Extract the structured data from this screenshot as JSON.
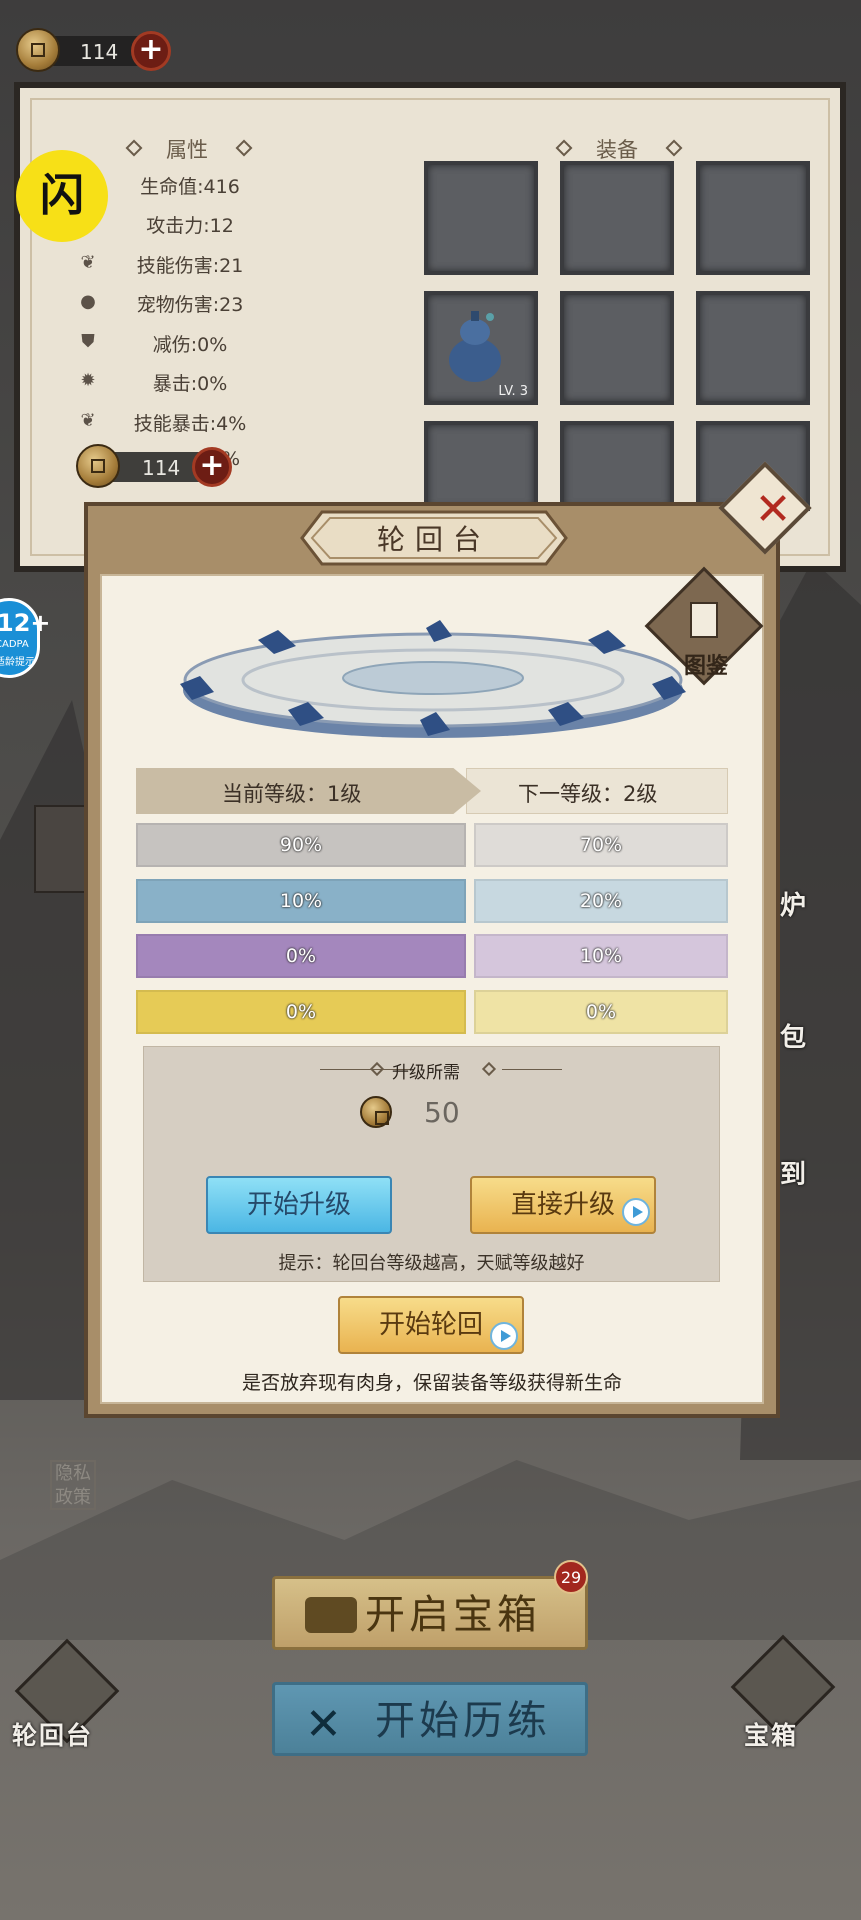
{
  "top_bar": {
    "coins": "114"
  },
  "stats_panel": {
    "attributes_title": "属性",
    "equipment_title": "装备",
    "stats": [
      {
        "label": "生命值:416",
        "icon": "heart-icon"
      },
      {
        "label": "攻击力:12",
        "icon": "sword-icon"
      },
      {
        "label": "技能伤害:21",
        "icon": "leaf-icon"
      },
      {
        "label": "宠物伤害:23",
        "icon": "paw-icon"
      },
      {
        "label": "减伤:0%",
        "icon": "shield-icon"
      },
      {
        "label": "暴击:0%",
        "icon": "burst-icon"
      },
      {
        "label": "技能暴击:4%",
        "icon": "leaf-icon"
      },
      {
        "label": "0%",
        "icon": "flame-icon"
      }
    ],
    "equipment_item_level": "LV. 3",
    "coins": "114"
  },
  "badge_flash": "闪",
  "age_rating": {
    "age": "12+",
    "line1": "CADPA",
    "line2": "适龄提示"
  },
  "modal": {
    "title": "轮回台",
    "illustrations_label": "图鉴",
    "current_level": "当前等级：1级",
    "next_level": "下一等级：2级",
    "rates": [
      {
        "current": "90%",
        "next": "70%",
        "color": "#c6c3c0",
        "next_color": "#dfdcd8"
      },
      {
        "current": "10%",
        "next": "20%",
        "color": "#89b1c8",
        "next_color": "#c7d8e0"
      },
      {
        "current": "0%",
        "next": "10%",
        "color": "#a487bd",
        "next_color": "#d5c6dc"
      },
      {
        "current": "0%",
        "next": "0%",
        "color": "#e6cb56",
        "next_color": "#efe3a5"
      }
    ],
    "requirement_title": "升级所需",
    "requirement_cost": "50",
    "start_upgrade": "开始升级",
    "direct_upgrade": "直接升级",
    "hint": "提示：轮回台等级越高，天赋等级越好",
    "start_reincarnation": "开始轮回",
    "reincarnation_desc": "是否放弃现有肉身，保留装备等级获得新生命"
  },
  "background": {
    "side_labels": [
      "炉",
      "包",
      "到"
    ],
    "privacy": "隐私政策",
    "open_chest": "开启宝箱",
    "chest_badge": "29",
    "start_training": "开始历练",
    "left_nav": "轮回台",
    "right_nav": "宝箱"
  }
}
